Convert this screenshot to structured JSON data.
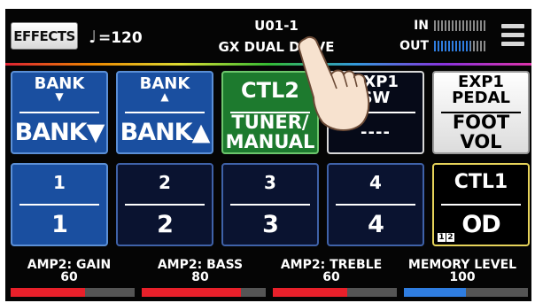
{
  "header": {
    "effects_label": "EFFECTS",
    "tempo_note": "♩",
    "tempo_text": "=120",
    "patch_number": "U01-1",
    "patch_name": "GX DUAL DRIVE",
    "in_label": "IN",
    "out_label": "OUT",
    "in_level": 0,
    "out_level": 0.7
  },
  "tiles_row1": [
    {
      "top_line1": "BANK",
      "top_arrow": "▼",
      "bottom": "BANK▼"
    },
    {
      "top_line1": "BANK",
      "top_arrow": "▲",
      "bottom": "BANK▲"
    },
    {
      "top_line1": "CTL2",
      "bottom_line1": "TUNER/",
      "bottom_line2": "MANUAL"
    },
    {
      "top_line1": "EXP1",
      "top_line2": "SW",
      "bottom": "----"
    },
    {
      "top_line1": "EXP1",
      "top_line2": "PEDAL",
      "bottom_line1": "FOOT",
      "bottom_line2": "VOL"
    }
  ],
  "tiles_row2": [
    {
      "top": "1",
      "bottom": "1"
    },
    {
      "top": "2",
      "bottom": "2"
    },
    {
      "top": "3",
      "bottom": "3"
    },
    {
      "top": "4",
      "bottom": "4"
    },
    {
      "top": "CTL1",
      "bottom": "OD",
      "badge": [
        "1",
        "2"
      ]
    }
  ],
  "params": [
    {
      "label": "AMP2: GAIN",
      "value": "60",
      "level": 0.6,
      "color": "#e8202a"
    },
    {
      "label": "AMP2: BASS",
      "value": "80",
      "level": 0.8,
      "color": "#e8202a"
    },
    {
      "label": "AMP2: TREBLE",
      "value": "60",
      "level": 0.6,
      "color": "#e8202a"
    },
    {
      "label": "MEMORY LEVEL",
      "value": "100",
      "level": 0.5,
      "color": "#2f7de0"
    }
  ]
}
